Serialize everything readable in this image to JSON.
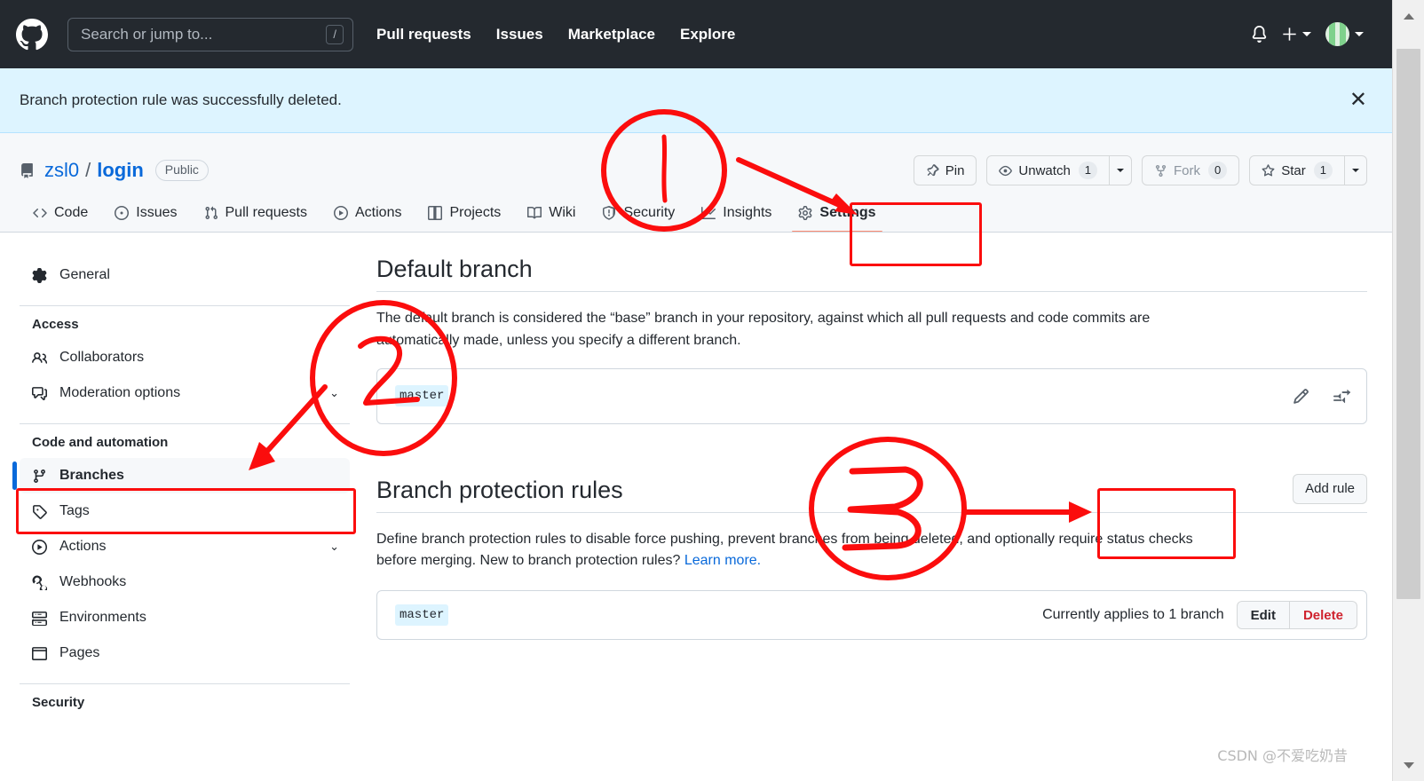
{
  "header": {
    "logo_icon": "github-mark-icon",
    "search": {
      "placeholder": "Search or jump to...",
      "shortcut_key": "/",
      "icon": "search-icon"
    },
    "nav": [
      {
        "label": "Pull requests"
      },
      {
        "label": "Issues"
      },
      {
        "label": "Marketplace"
      },
      {
        "label": "Explore"
      }
    ],
    "right": {
      "notifications_icon": "bell-icon",
      "create_new_icon": "plus-icon",
      "account_icon": "avatar-icon"
    }
  },
  "flash": {
    "message": "Branch protection rule was successfully deleted.",
    "close_label": "✕",
    "bg_color": "#ddf4ff"
  },
  "repo": {
    "icon": "repo-icon",
    "owner": "zsl0",
    "separator": "/",
    "name": "login",
    "visibility": "Public",
    "actions": {
      "pin": {
        "label": "Pin",
        "icon": "pin-icon"
      },
      "watch": {
        "label": "Unwatch",
        "count": "1",
        "icon": "eye-icon"
      },
      "fork": {
        "label": "Fork",
        "count": "0",
        "icon": "fork-icon",
        "disabled": true
      },
      "star": {
        "label": "Star",
        "count": "1",
        "icon": "star-icon"
      }
    },
    "tabs": [
      {
        "label": "Code",
        "icon": "code-icon",
        "active": false
      },
      {
        "label": "Issues",
        "icon": "issue-opened-icon",
        "active": false
      },
      {
        "label": "Pull requests",
        "icon": "git-pull-request-icon",
        "active": false
      },
      {
        "label": "Actions",
        "icon": "play-icon",
        "active": false
      },
      {
        "label": "Projects",
        "icon": "table-icon",
        "active": false
      },
      {
        "label": "Wiki",
        "icon": "book-icon",
        "active": false
      },
      {
        "label": "Security",
        "icon": "shield-icon",
        "active": false
      },
      {
        "label": "Insights",
        "icon": "graph-icon",
        "active": false
      },
      {
        "label": "Settings",
        "icon": "gear-icon",
        "active": true
      }
    ]
  },
  "sidebar": {
    "general": {
      "label": "General",
      "icon": "gear-icon"
    },
    "groups": [
      {
        "title": "Access",
        "items": [
          {
            "label": "Collaborators",
            "icon": "people-icon",
            "chevron": false,
            "selected": false
          },
          {
            "label": "Moderation options",
            "icon": "comment-discussion-icon",
            "chevron": true,
            "selected": false
          }
        ]
      },
      {
        "title": "Code and automation",
        "items": [
          {
            "label": "Branches",
            "icon": "git-branch-icon",
            "chevron": false,
            "selected": true
          },
          {
            "label": "Tags",
            "icon": "tag-icon",
            "chevron": false,
            "selected": false
          },
          {
            "label": "Actions",
            "icon": "play-icon",
            "chevron": true,
            "selected": false
          },
          {
            "label": "Webhooks",
            "icon": "webhook-icon",
            "chevron": false,
            "selected": false
          },
          {
            "label": "Environments",
            "icon": "server-icon",
            "chevron": false,
            "selected": false
          },
          {
            "label": "Pages",
            "icon": "browser-icon",
            "chevron": false,
            "selected": false
          }
        ]
      },
      {
        "title": "Security",
        "items": []
      }
    ],
    "chevron_glyph": "⌄"
  },
  "main": {
    "default_branch": {
      "title": "Default branch",
      "description": "The default branch is considered the “base” branch in your repository, against which all pull requests and code commits are automatically made, unless you specify a different branch.",
      "branch_name": "master",
      "edit_icon": "pencil-icon",
      "switch_icon": "arrow-switch-icon"
    },
    "protection_rules": {
      "title": "Branch protection rules",
      "add_rule_label": "Add rule",
      "description_pre": "Define branch protection rules to disable force pushing, prevent branches from being deleted, and optionally require status checks before merging. New to branch protection rules? ",
      "learn_more_label": "Learn more.",
      "rules": [
        {
          "pattern": "master",
          "applies_text": "Currently applies to 1 branch",
          "edit_label": "Edit",
          "delete_label": "Delete"
        }
      ]
    }
  },
  "annotations": {
    "step_1": "1",
    "step_2": "2",
    "step_3": "3",
    "color": "#fb0d0d"
  },
  "watermark": "CSDN @不爱吃奶昔",
  "scrollbar": {
    "up_icon": "scroll-up-arrow-icon",
    "down_icon": "scroll-down-arrow-icon"
  }
}
